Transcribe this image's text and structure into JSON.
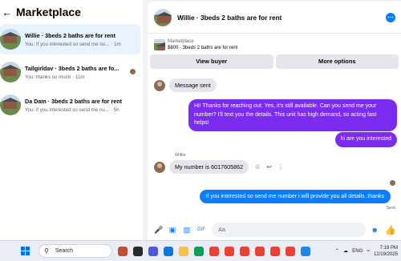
{
  "marketplace": {
    "title": "Marketplace",
    "conversations": [
      {
        "title": "Willie · 3beds 2 baths are for rent",
        "preview": "You: If you interested so send me nu...",
        "time": "· 1m",
        "active": true
      },
      {
        "title": "Tallgirldav · 3beds 2 baths are fo...",
        "preview": "You: thanks so much",
        "time": "· 11m",
        "active": false
      },
      {
        "title": "Da Dam · 3beds 2 baths are for rent",
        "preview": "You: if you interested so send me nu...",
        "time": "· 5h",
        "active": false
      }
    ]
  },
  "thread": {
    "title": "Willie · 3beds 2 baths are for rent",
    "listing_label": "Marketplace",
    "listing_info": "$800 · 3beds 2 baths are for rent",
    "view_buyer": "View buyer",
    "more_options": "More options",
    "messages": {
      "message_sent": "Message sent",
      "reply_1": "Hi! Thanks for reaching out. Yes, it's still available. Can you send me your number? I'll text you the details. This unit has high demand, so acting fast helps!",
      "reply_2": "hi are you interested",
      "sender_name": "Willie",
      "incoming": "My number is 6017605862",
      "outgoing": "if you interested so send me number i will provide you all details .thanks",
      "status": "Sent"
    },
    "composer_placeholder": "Aa"
  },
  "taskbar": {
    "search_placeholder": "Search",
    "language": "ENG",
    "time": "7:19 PM",
    "date": "12/19/2025"
  },
  "colors": {
    "accent": "#0a7cff",
    "purple_bubble": "#7b2cf0",
    "active_row": "#e7f3ff"
  }
}
